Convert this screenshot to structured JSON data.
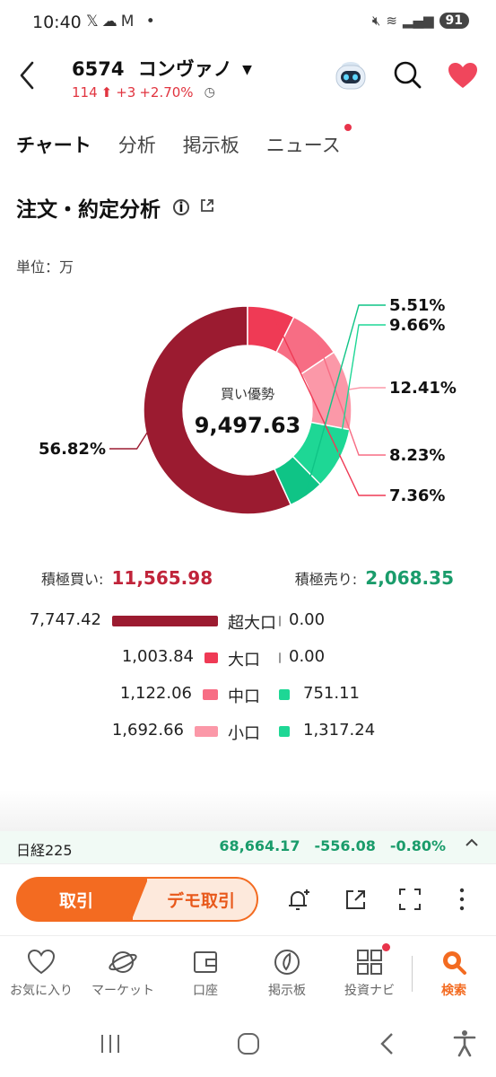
{
  "status": {
    "time": "10:40",
    "battery": "91"
  },
  "header": {
    "stock_code": "6574",
    "stock_name": "コンヴァノ",
    "price": "114",
    "change": "+3",
    "change_pct": "+2.70%"
  },
  "tabs": [
    {
      "label": "チャート"
    },
    {
      "label": "分析"
    },
    {
      "label": "掲示板"
    },
    {
      "label": "ニュース"
    }
  ],
  "section": {
    "title": "注文・約定分析",
    "unit": "単位：万"
  },
  "chart_data": {
    "type": "pie",
    "center_label": "買い優勢",
    "center_value": "9,497.63",
    "slices": [
      {
        "label": "56.82%",
        "value": 56.82,
        "color": "#9b1b30"
      },
      {
        "label": "7.36%",
        "value": 7.36,
        "color": "#ef3a55"
      },
      {
        "label": "8.23%",
        "value": 8.23,
        "color": "#f76d84"
      },
      {
        "label": "12.41%",
        "value": 12.41,
        "color": "#fb98a8"
      },
      {
        "label": "9.66%",
        "value": 9.66,
        "color": "#1ed795"
      },
      {
        "label": "5.51%",
        "value": 5.51,
        "color": "#0fc486"
      }
    ]
  },
  "aggressive": {
    "buy_label": "積極買い:",
    "buy_value": "11,565.98",
    "sell_label": "積極売り:",
    "sell_value": "2,068.35"
  },
  "breakdown": [
    {
      "buy": "7,747.42",
      "buy_num": 7747.42,
      "category": "超大口",
      "sell": "0.00",
      "sell_num": 0,
      "buy_color": "#9b1b30",
      "sell_color": "#0fc486"
    },
    {
      "buy": "1,003.84",
      "buy_num": 1003.84,
      "category": "大口",
      "sell": "0.00",
      "sell_num": 0,
      "buy_color": "#ef3a55",
      "sell_color": "#0fc486"
    },
    {
      "buy": "1,122.06",
      "buy_num": 1122.06,
      "category": "中口",
      "sell": "751.11",
      "sell_num": 751.11,
      "buy_color": "#f76d84",
      "sell_color": "#1ed795"
    },
    {
      "buy": "1,692.66",
      "buy_num": 1692.66,
      "category": "小口",
      "sell": "1,317.24",
      "sell_num": 1317.24,
      "buy_color": "#fb98a8",
      "sell_color": "#1ed795"
    }
  ],
  "index": {
    "name": "日経225",
    "value": "68,664.17",
    "change": "-556.08",
    "change_pct": "-0.80%"
  },
  "actions": {
    "trade": "取引",
    "demo": "デモ取引"
  },
  "bottom_nav": [
    {
      "label": "お気に入り",
      "icon": "heart-icon"
    },
    {
      "label": "マーケット",
      "icon": "planet-icon"
    },
    {
      "label": "口座",
      "icon": "wallet-icon"
    },
    {
      "label": "掲示板",
      "icon": "board-icon"
    },
    {
      "label": "投資ナビ",
      "icon": "grid-icon"
    },
    {
      "label": "検索",
      "icon": "search-icon"
    }
  ]
}
